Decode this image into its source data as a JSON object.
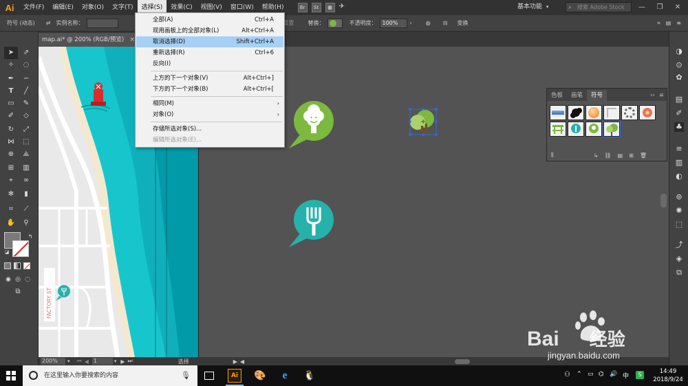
{
  "app": {
    "logo": "Ai",
    "menus": [
      "文件(F)",
      "编辑(E)",
      "对象(O)",
      "文字(T)",
      "选择(S)",
      "效果(C)",
      "视图(V)",
      "窗口(W)",
      "帮助(H)"
    ],
    "bridge_label": "Br",
    "stock_label": "St",
    "workspace": "基本功能",
    "stock_placeholder": "搜索 Adobe Stock"
  },
  "control_bar": {
    "label": "符号 (动态)",
    "instance_label": "实例名称：",
    "instance_value": "",
    "reset_label": "重置",
    "replace_label": "替换：",
    "opacity_label": "不透明度：",
    "opacity_value": "100%",
    "transform_label": "变换"
  },
  "document": {
    "tab_title": "map.ai* @ 200% (RGB/预览)",
    "tab_close": "×",
    "street_label": "FACTORY ST"
  },
  "status": {
    "zoom": "200%",
    "page": "1",
    "tool": "选择"
  },
  "select_menu": {
    "items": [
      {
        "label": "全部(A)",
        "shortcut": "Ctrl+A"
      },
      {
        "label": "现用画板上的全部对象(L)",
        "shortcut": "Alt+Ctrl+A"
      },
      {
        "label": "取消选择(D)",
        "shortcut": "Shift+Ctrl+A"
      },
      {
        "label": "重新选择(R)",
        "shortcut": "Ctrl+6"
      },
      {
        "label": "反向(I)",
        "shortcut": ""
      },
      {
        "label": "上方的下一个对象(V)",
        "shortcut": "Alt+Ctrl+]"
      },
      {
        "label": "下方的下一个对象(B)",
        "shortcut": "Alt+Ctrl+["
      },
      {
        "label": "相同(M)",
        "shortcut": ""
      },
      {
        "label": "对象(O)",
        "shortcut": ""
      },
      {
        "label": "存储所选对象(S)...",
        "shortcut": ""
      },
      {
        "label": "编辑所选对象(E)...",
        "shortcut": ""
      }
    ],
    "submenu_arrow": "›"
  },
  "symbols_panel": {
    "tabs": [
      "色板",
      "画笔",
      "符号"
    ],
    "active_tab": "符号",
    "collapse_glyph": "››"
  },
  "taskbar": {
    "search_placeholder": "在这里输入你要搜索的内容",
    "time": "14:49",
    "date": "2018/9/24"
  },
  "watermark": {
    "brand": "Bai",
    "brand_suffix": "经验",
    "url": "jingyan.baidu.com"
  },
  "colors": {
    "menubar_bg": "#323232",
    "panel_bg": "#424242",
    "canvas_bg": "#535353",
    "menu_highlight": "#a6d0f5",
    "tree_green": "#7cb93f",
    "teal": "#26b2ab",
    "sea_dark": "#009aa8",
    "sea_light": "#16c6cc",
    "selection_blue": "#2b6fff",
    "ai_orange": "#f7a01c"
  },
  "icons": [
    "selection-arrow-icon",
    "direct-selection-icon",
    "magic-wand-icon",
    "lasso-icon",
    "pen-icon",
    "type-icon",
    "line-icon",
    "rectangle-icon",
    "paintbrush-icon",
    "pencil-icon",
    "rotate-icon",
    "scale-icon",
    "eraser-icon",
    "width-icon",
    "free-transform-icon",
    "shape-builder-icon",
    "perspective-icon",
    "mesh-icon",
    "gradient-icon",
    "eyedropper-icon",
    "blend-icon",
    "symbol-sprayer-icon",
    "column-graph-icon",
    "artboard-icon",
    "slice-icon",
    "hand-icon",
    "zoom-icon",
    "tree-marker-icon",
    "fork-marker-icon",
    "buoy-icon"
  ]
}
